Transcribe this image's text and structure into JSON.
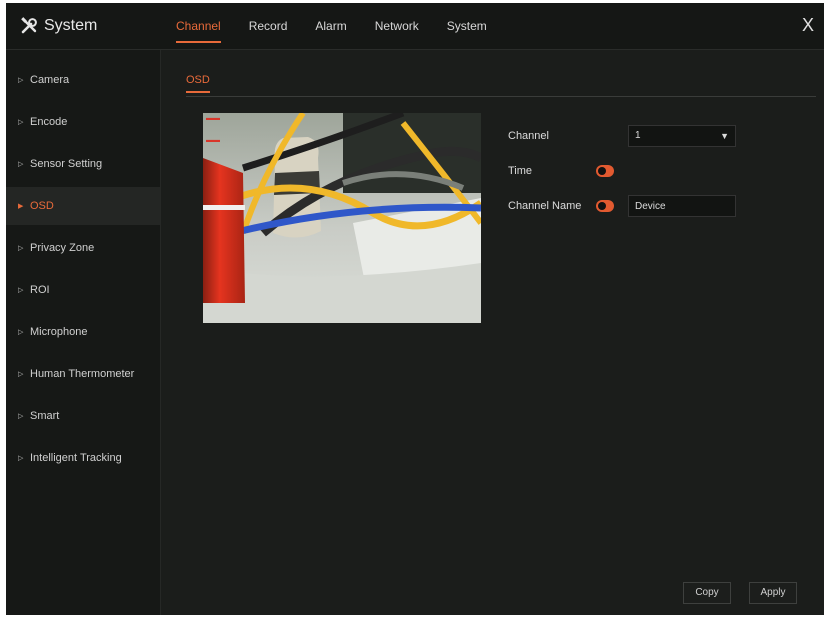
{
  "app": {
    "title": "System",
    "close_symbol": "X"
  },
  "nav": {
    "tabs": [
      {
        "label": "Channel",
        "active": true
      },
      {
        "label": "Record",
        "active": false
      },
      {
        "label": "Alarm",
        "active": false
      },
      {
        "label": "Network",
        "active": false
      },
      {
        "label": "System",
        "active": false
      }
    ]
  },
  "sidebar": {
    "items": [
      {
        "label": "Camera",
        "active": false
      },
      {
        "label": "Encode",
        "active": false
      },
      {
        "label": "Sensor Setting",
        "active": false
      },
      {
        "label": "OSD",
        "active": true
      },
      {
        "label": "Privacy Zone",
        "active": false
      },
      {
        "label": "ROI",
        "active": false
      },
      {
        "label": "Microphone",
        "active": false
      },
      {
        "label": "Human Thermometer",
        "active": false
      },
      {
        "label": "Smart",
        "active": false
      },
      {
        "label": "Intelligent Tracking",
        "active": false
      }
    ]
  },
  "content": {
    "subtab": "OSD",
    "form": {
      "channel_label": "Channel",
      "channel_value": "1",
      "time_label": "Time",
      "time_enabled": true,
      "channel_name_label": "Channel Name",
      "channel_name_enabled": true,
      "channel_name_value": "Device"
    },
    "buttons": {
      "copy": "Copy",
      "apply": "Apply"
    }
  },
  "colors": {
    "accent": "#e86a3a",
    "background": "#1b1d1b",
    "sidebar": "#161816"
  },
  "icons": {
    "brand": "tools-icon",
    "close": "close-icon",
    "sidebar_arrow": "triangle-right-icon",
    "dropdown": "chevron-down-icon"
  }
}
